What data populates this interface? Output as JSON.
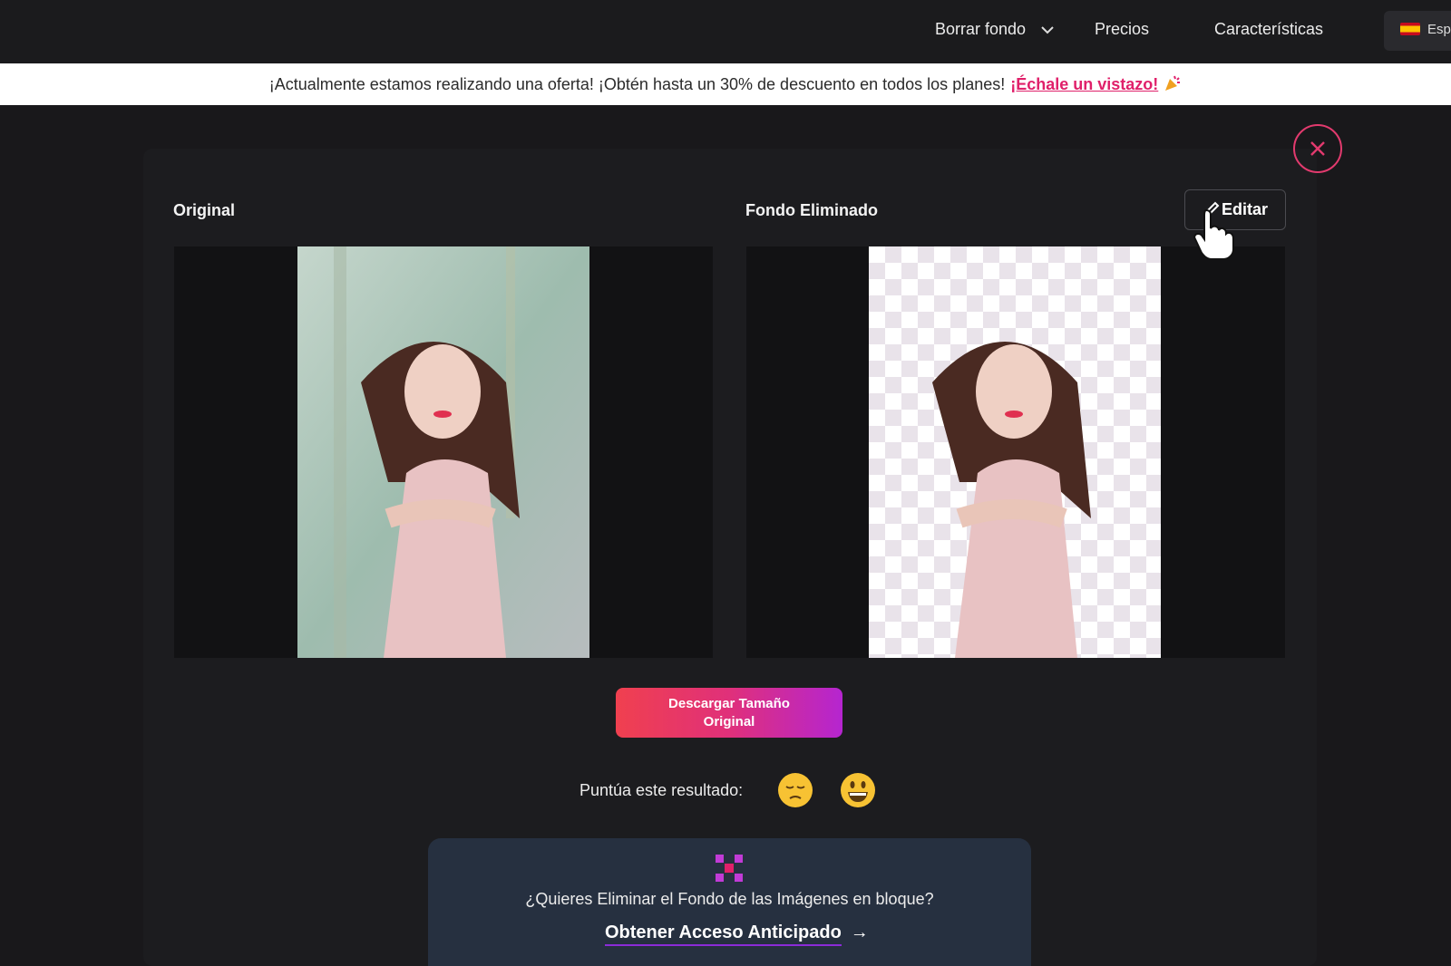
{
  "nav": {
    "items": [
      {
        "label": "Borrar fondo",
        "has_dropdown": true
      },
      {
        "label": "Precios"
      },
      {
        "label": "Características"
      }
    ],
    "language": "Esp"
  },
  "promo": {
    "text": "¡Actualmente estamos realizando una oferta! ¡Obtén hasta un 30% de descuento en todos los planes!",
    "link": "¡Échale un vistazo!",
    "icon": "party-popper-icon"
  },
  "result": {
    "original_label": "Original",
    "removed_label": "Fondo Eliminado",
    "edit_label": "Editar",
    "close_icon": "close-icon"
  },
  "download": {
    "line1": "Descargar Tamaño",
    "line2": "Original"
  },
  "rating": {
    "label": "Puntúa este resultado:",
    "options": [
      "sad-face-icon",
      "grinning-face-icon"
    ]
  },
  "bulk": {
    "question": "¿Quieres Eliminar el Fondo de las Imágenes en bloque?",
    "link": "Obtener Acceso Anticipado",
    "arrow": "→"
  },
  "colors": {
    "accent_pink": "#e0206a",
    "gradient_start": "#f0404f",
    "gradient_end": "#b525d0",
    "background": "#19181b"
  }
}
